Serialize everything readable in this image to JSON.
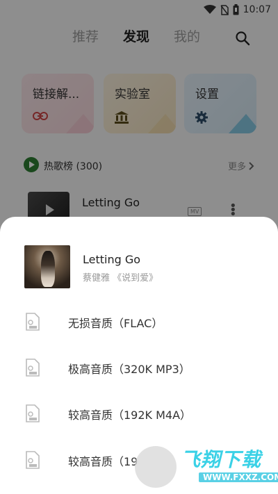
{
  "status_bar": {
    "time": "10:07",
    "icons": [
      "wifi-icon",
      "no-sim-icon",
      "battery-icon"
    ]
  },
  "nav": {
    "tabs": [
      "推荐",
      "发现",
      "我的"
    ],
    "active_index": 1,
    "search_icon": "search-icon"
  },
  "cards": [
    {
      "label": "链接解...",
      "icon": "link-icon",
      "color": "#f3d6da"
    },
    {
      "label": "实验室",
      "icon": "bank-icon",
      "color": "#f1e0bf"
    },
    {
      "label": "设置",
      "icon": "gear-icon",
      "color": "#d3e5f1"
    }
  ],
  "hot_list": {
    "title": "热歌榜 (300)",
    "more": "更多"
  },
  "song_row": {
    "title": "Letting Go",
    "badge": "MV"
  },
  "sheet": {
    "song_title": "Letting Go",
    "artist": "蔡健雅 《说到爱》",
    "options": [
      {
        "label": "无损音质（FLAC）"
      },
      {
        "label": "极高音质（320K MP3）"
      },
      {
        "label": "较高音质（192K M4A）"
      },
      {
        "label": "较高音质（19"
      }
    ]
  },
  "watermark": {
    "text": "飞翔下载",
    "url": "WWW.FXXZ.COM"
  },
  "colors": {
    "accent_green": "#2e7d32",
    "watermark_cyan": "#3ad1e6"
  }
}
